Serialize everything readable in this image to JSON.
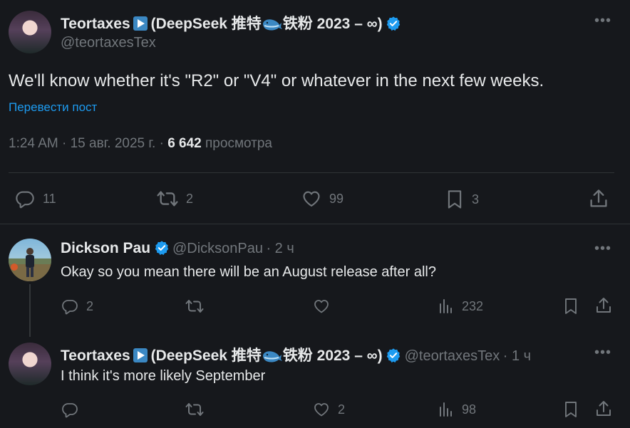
{
  "main_tweet": {
    "author_name": "Teortaxes",
    "author_name_suffix_1": "(DeepSeek 推特",
    "author_name_suffix_2": "铁粉 2023 – ∞)",
    "handle": "@teortaxesTex",
    "text": "We'll know whether it's \"R2\" or \"V4\" or whatever in the next few weeks.",
    "translate_label": "Перевести пост",
    "time": "1:24 AM",
    "date": "15 авг. 2025 г.",
    "views_count": "6 642",
    "views_label": "просмотра",
    "stats": {
      "replies": "11",
      "reposts": "2",
      "likes": "99",
      "bookmarks": "3"
    }
  },
  "replies": [
    {
      "author_name": "Dickson Pau",
      "handle": "@DicksonPau",
      "time_ago": "2 ч",
      "text": "Okay so you mean there will be an August release after all?",
      "stats": {
        "replies": "2",
        "reposts": "",
        "likes": "",
        "views": "232"
      }
    },
    {
      "author_name": "Teortaxes",
      "author_name_suffix_1": "(DeepSeek 推特",
      "author_name_suffix_2": "铁粉 2023 – ∞)",
      "handle": "@teortaxesTex",
      "time_ago": "1 ч",
      "text": "I think it's more likely September",
      "stats": {
        "replies": "",
        "reposts": "",
        "likes": "2",
        "views": "98"
      }
    }
  ],
  "colors": {
    "background": "#16181c",
    "text": "#e7e9ea",
    "muted": "#71767b",
    "accent": "#1d9bf0",
    "verified": "#1d9bf0"
  },
  "icons": {
    "reply": "reply-icon",
    "repost": "repost-icon",
    "like": "heart-icon",
    "bookmark": "bookmark-icon",
    "share": "share-icon",
    "views": "views-icon",
    "more": "more-icon",
    "verified": "verified-badge-icon"
  }
}
